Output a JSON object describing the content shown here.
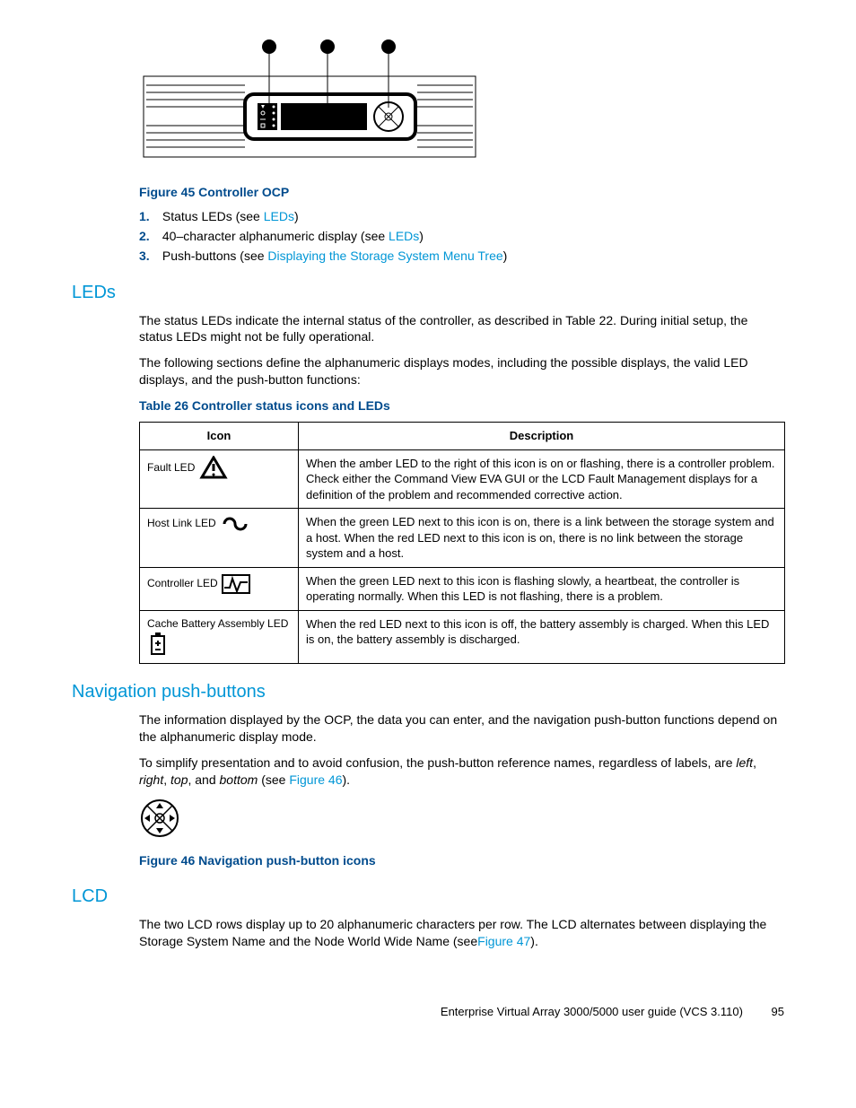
{
  "figure45": {
    "caption": "Figure 45 Controller OCP",
    "items": [
      {
        "num": "1.",
        "text_a": "Status LEDs (see ",
        "link": "LEDs",
        "text_b": ")"
      },
      {
        "num": "2.",
        "text_a": "40–character alphanumeric display (see ",
        "link": "LEDs",
        "text_b": ")"
      },
      {
        "num": "3.",
        "text_a": "Push-buttons (see ",
        "link": "Displaying the Storage System Menu Tree",
        "text_b": ")"
      }
    ]
  },
  "leds": {
    "heading": "LEDs",
    "p1": "The status LEDs indicate the internal status of the controller, as described in Table 22. During initial setup, the status LEDs might not be fully operational.",
    "p2": "The following sections define the alphanumeric displays modes, including the possible displays, the valid LED displays, and the push-button functions:"
  },
  "table26": {
    "caption": "Table 26 Controller status icons and LEDs",
    "head_icon": "Icon",
    "head_desc": "Description",
    "rows": [
      {
        "label": "Fault LED",
        "desc": "When the amber LED to the right of this icon is on or flashing, there is a controller problem. Check either the Command View EVA GUI or the LCD Fault Management displays for a definition of the problem and recommended corrective action."
      },
      {
        "label": "Host Link LED",
        "desc": "When the green LED next to this icon is on, there is a link between the storage system and a host. When the red LED next to this icon is on, there is no link between the storage system and a host."
      },
      {
        "label": "Controller LED",
        "desc": "When the green LED next to this icon is flashing slowly, a heartbeat, the controller is operating normally. When this LED is not flashing, there is a problem."
      },
      {
        "label": "Cache Battery Assembly LED",
        "desc": "When the red LED next to this icon is off, the battery assembly is charged. When this LED is on, the battery assembly is discharged."
      }
    ]
  },
  "navpb": {
    "heading": "Navigation push-buttons",
    "p1": "The information displayed by the OCP, the data you can enter, and the navigation push-button functions depend on the alphanumeric display mode.",
    "p2_a": "To simplify presentation and to avoid confusion, the push-button reference names, regardless of labels, are ",
    "p2_left": "left",
    "p2_c1": ", ",
    "p2_right": "right",
    "p2_c2": ", ",
    "p2_top": "top",
    "p2_c3": ", and ",
    "p2_bottom": "bottom",
    "p2_b": " (see ",
    "p2_link": "Figure 46",
    "p2_c4": ")."
  },
  "figure46": {
    "caption": "Figure 46 Navigation push-button icons"
  },
  "lcd": {
    "heading": "LCD",
    "p1_a": "The two LCD rows display up to 20 alphanumeric characters per row. The LCD alternates between displaying the Storage System Name and the Node World Wide Name (see",
    "p1_link": "Figure 47",
    "p1_b": ")."
  },
  "footer": {
    "text": "Enterprise Virtual Array 3000/5000 user guide (VCS 3.110)",
    "page": "95"
  }
}
